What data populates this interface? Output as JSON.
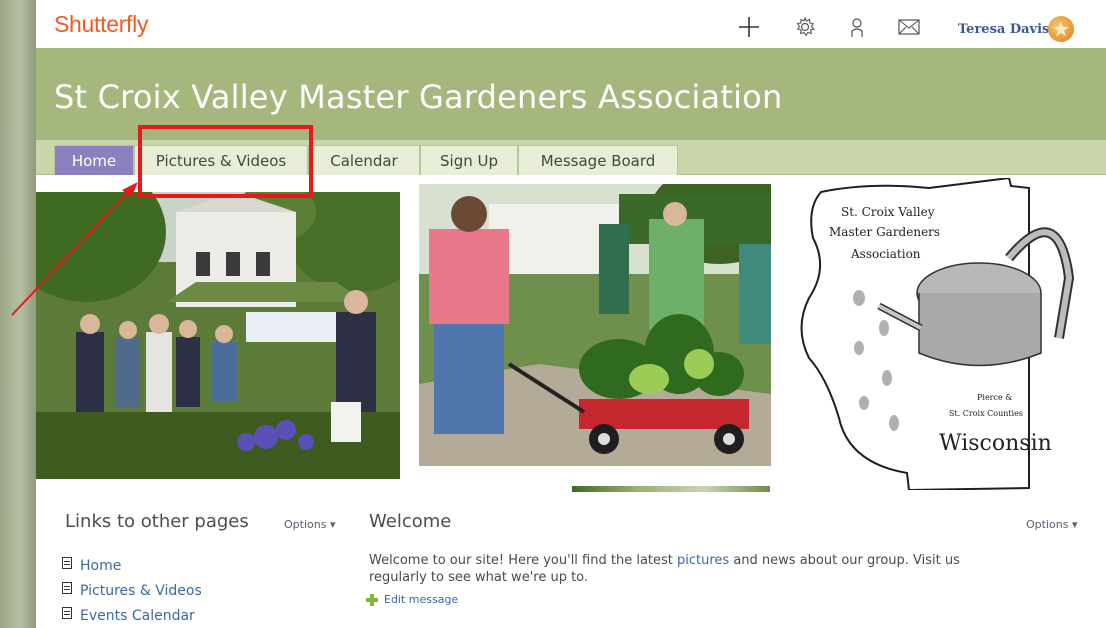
{
  "header": {
    "logo": "Shutterfly",
    "user_name": "Teresa Davis",
    "icons": [
      "plus-icon",
      "gear-icon",
      "person-icon",
      "envelope-icon"
    ]
  },
  "site": {
    "title": "St Croix Valley Master Gardeners Association"
  },
  "nav": {
    "items": [
      {
        "label": "Home",
        "active": true
      },
      {
        "label": "Pictures & Videos"
      },
      {
        "label": "Calendar"
      },
      {
        "label": "Sign Up"
      },
      {
        "label": "Message Board"
      }
    ]
  },
  "logo_art": {
    "line1": "St. Croix Valley",
    "line2": "Master Gardeners",
    "line3": "Association",
    "county1": "Pierce &",
    "county2": "St. Croix Counties",
    "state": "Wisconsin"
  },
  "links": {
    "title": "Links to other pages",
    "options": "Options ▾",
    "items": [
      "Home",
      "Pictures & Videos",
      "Events Calendar"
    ]
  },
  "welcome": {
    "title": "Welcome",
    "options": "Options ▾",
    "text_before": "Welcome to our site! Here you'll find the latest ",
    "text_link": "pictures",
    "text_after_line1": " and news about our group. Visit us",
    "text_line2": "regularly to see what we're up to.",
    "edit": "Edit message"
  },
  "colors": {
    "brand": "#f15a22",
    "banner": "#a5b77c",
    "nav_active": "#8c80c0",
    "annotation": "#e8191b",
    "link": "#3a68a8"
  }
}
